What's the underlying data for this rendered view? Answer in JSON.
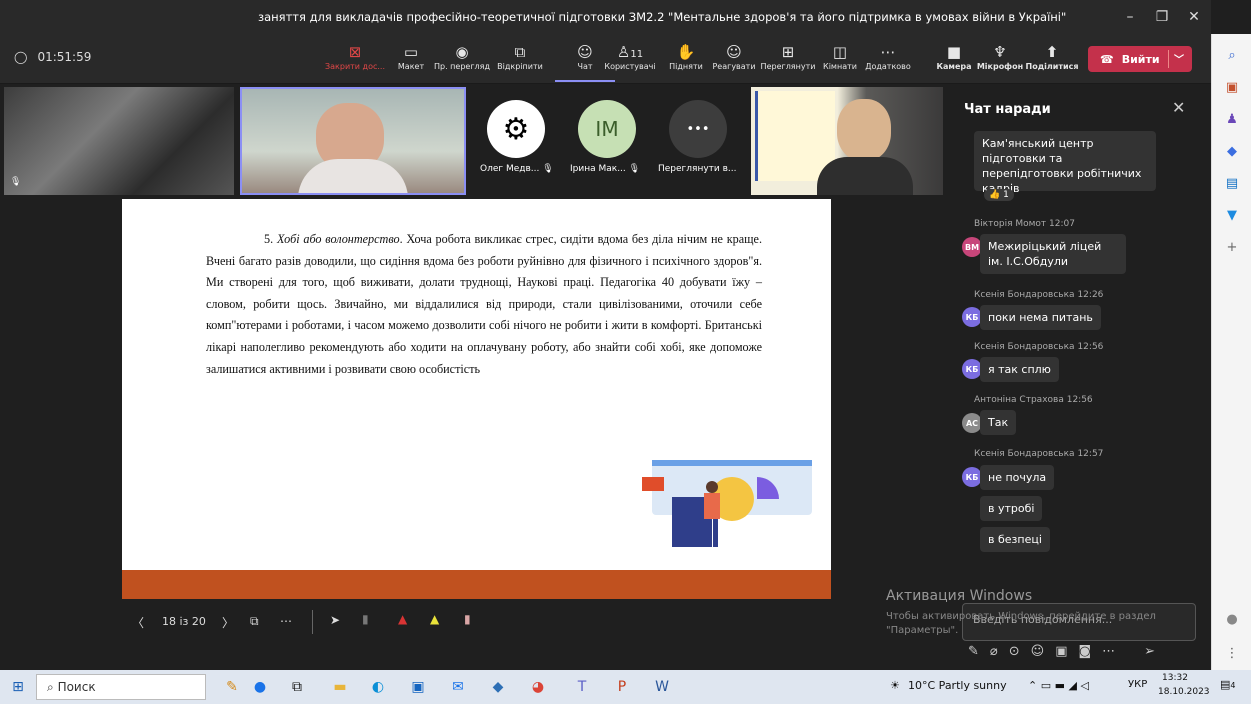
{
  "window": {
    "title": "заняття для викладачів професійно-теоретичної підготовки ЗМ2.2 \"Ментальне здоров'я та його підтримка в умовах війни в Україні\"",
    "controls": [
      "–",
      "❐",
      "✕"
    ]
  },
  "toolbar": {
    "timer": "01:51:59",
    "stop_share": "Закрити дос...",
    "layout": "Макет",
    "view": "Пр. перегляд",
    "unpin": "Відкріпити",
    "chat": "Чат",
    "people": "Користувачі",
    "people_count": "11",
    "raise": "Підняти",
    "react": "Реагувати",
    "rooms_view": "Переглянути",
    "rooms": "Кімнати",
    "more": "Додатково",
    "camera": "Камера",
    "mic": "Мікрофон",
    "share": "Поділитися",
    "leave": "Вийти"
  },
  "participants": {
    "p1": "Олег Медв...",
    "p2_initials": "ІМ",
    "p2": "Ірина Мак...",
    "p3": "Переглянути в...",
    "more_dots": "•••"
  },
  "slide": {
    "heading_num": "5.",
    "heading_italic": "Хобі або волонтерство",
    "body": ". Хоча робота викликає стрес, сидіти вдома без діла нічим не краще. Вчені багато разів доводили, що сидіння вдома без роботи руйнівно для фізичного і психічного здоров\"я. Ми створені для того, щоб виживати, долати труднощі, Наукові праці. Педагогіка  40 добувати їжу – словом, робити щось. Звичайно, ми віддалилися від природи, стали цивілізованими, оточили себе комп\"ютерами і роботами, і часом можемо дозволити собі нічого не робити і жити в комфорті. Британські лікарі наполегливо рекомендують або ходити на оплачувану роботу, або знайти собі хобі, яке допоможе залишатися активними і розвивати свою особистість"
  },
  "slide_controls": {
    "pager": "18 із 20"
  },
  "chat": {
    "header": "Чат наради",
    "messages": [
      {
        "text": "Кам'янський центр підготовки та перепідготовки робітничих кадрів",
        "reaction": "1"
      },
      {
        "author": "Вікторія Момот",
        "time": "12:07",
        "initials": "ВМ",
        "text": "Межирiцький лiцей iм. I.С.Обдули"
      },
      {
        "author": "Ксенія Бондаровська",
        "time": "12:26",
        "initials": "КБ",
        "text": "поки нема питань"
      },
      {
        "author": "Ксенія Бондаровська",
        "time": "12:56",
        "initials": "КБ",
        "text": "я так сплю"
      },
      {
        "author": "Антоніна Страхова",
        "time": "12:56",
        "initials": "АС",
        "text": "Так"
      },
      {
        "author": "Ксенія Бондаровська",
        "time": "12:57",
        "initials": "КБ",
        "text": "не почула"
      },
      {
        "text": "в утробі"
      },
      {
        "text": "в безпеці"
      }
    ],
    "composer_placeholder": "Введіть повідомлення..."
  },
  "watermark": {
    "title": "Активация Windows",
    "subtitle": "Чтобы активировать Windows, перейдите в раздел \"Параметры\"."
  },
  "taskbar": {
    "search": "Поиск",
    "weather": "10°C  Partly sunny",
    "lang": "УКР",
    "time": "13:32",
    "date": "18.10.2023",
    "notif": "4"
  },
  "colors": {
    "accent": "#8b8ff4",
    "leave": "#c4314b",
    "slide_bar": "#c0511f"
  }
}
